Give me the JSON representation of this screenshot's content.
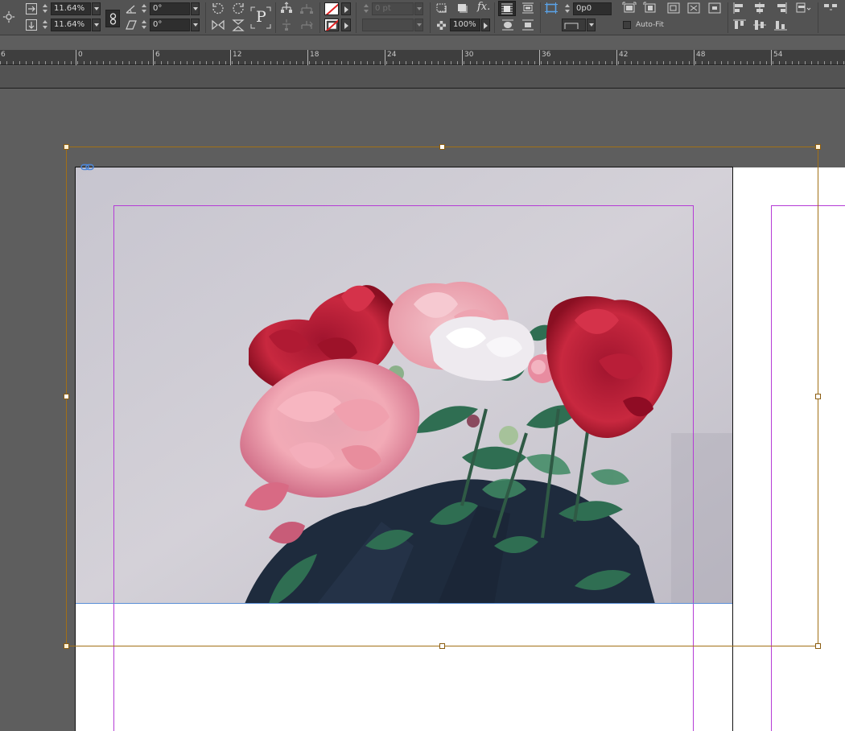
{
  "control_panel": {
    "scale_x": "11.64%",
    "scale_y": "11.64%",
    "rotation_angle": "0°",
    "shear_angle": "0°",
    "stroke_weight": "0 pt",
    "opacity": "100%",
    "fitting_offset": "0p0",
    "auto_fit_label": "Auto-Fit",
    "text_frame_icon": "P"
  },
  "ruler": {
    "labels": [
      "6",
      "0",
      "6",
      "12",
      "18",
      "24",
      "30",
      "36",
      "42",
      "48",
      "54"
    ]
  },
  "colors": {
    "app_bg": "#535353",
    "pasteboard": "#5e5e5e",
    "frame_selection": "#a27016",
    "margin_guide": "#b53bd6",
    "page": "#ffffff"
  }
}
